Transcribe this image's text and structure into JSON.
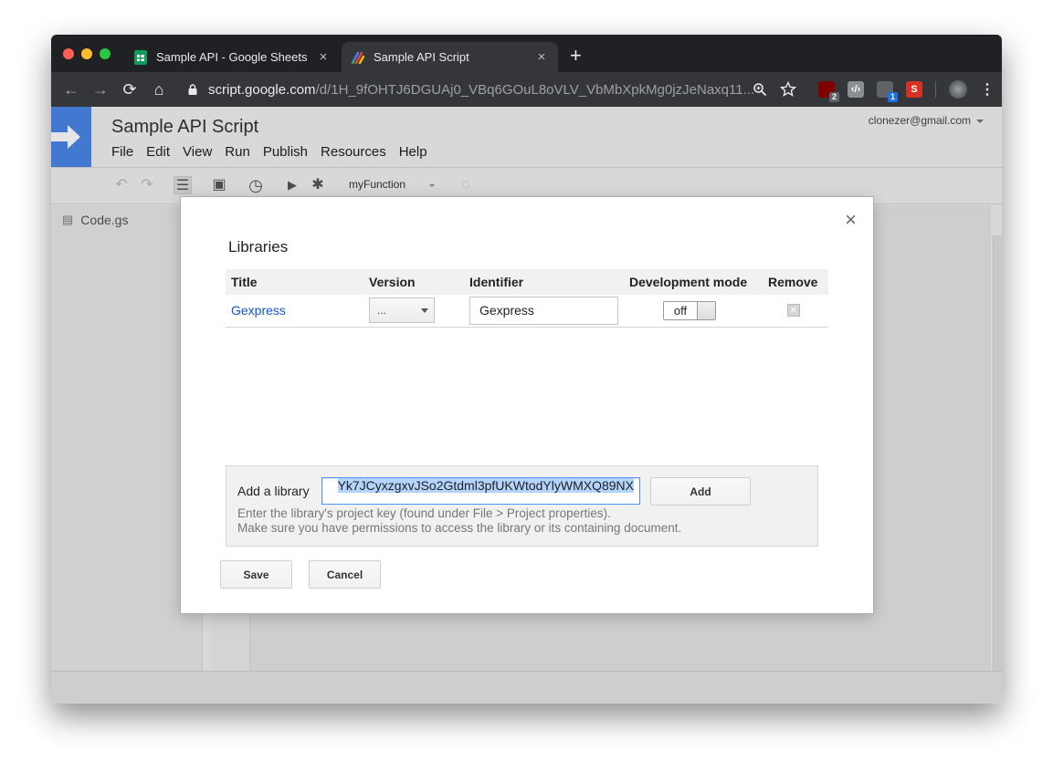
{
  "browser": {
    "tabs": [
      {
        "title": "Sample API - Google Sheets",
        "close": "×"
      },
      {
        "title": "Sample API Script",
        "close": "×"
      }
    ],
    "new_tab": "+",
    "url_host": "script.google.com",
    "url_path": "/d/1H_9fOHTJ6DGUAj0_VBq6GOuL8oVLV_VbMbXpkMg0jzJeNaxq11...",
    "ext_badges": {
      "ublock": "2",
      "ext3": "1"
    },
    "ext_s_label": "S"
  },
  "app": {
    "doc_title": "Sample API Script",
    "account": "clonezer@gmail.com",
    "menu": [
      "File",
      "Edit",
      "View",
      "Run",
      "Publish",
      "Resources",
      "Help"
    ],
    "function_select": "myFunction",
    "file_name": "Code.gs"
  },
  "dialog": {
    "title": "Libraries",
    "close": "×",
    "columns": [
      "Title",
      "Version",
      "Identifier",
      "Development mode",
      "Remove"
    ],
    "rows": [
      {
        "title": "Gexpress",
        "version": "...",
        "identifier": "Gexpress",
        "dev_mode": "off"
      }
    ],
    "add_label": "Add a library",
    "add_value": "Yk7JCyxzgxvJSo2Gtdml3pfUKWtodYlyWMXQ89NX",
    "add_button": "Add",
    "help_line1": "Enter the library's project key (found under File > Project properties).",
    "help_line2": "Make sure you have permissions to access the library or its containing document.",
    "save": "Save",
    "cancel": "Cancel"
  },
  "colors": {
    "accent_blue": "#4a86e8",
    "link": "#1155cc",
    "selection": "#b3d4fc"
  }
}
